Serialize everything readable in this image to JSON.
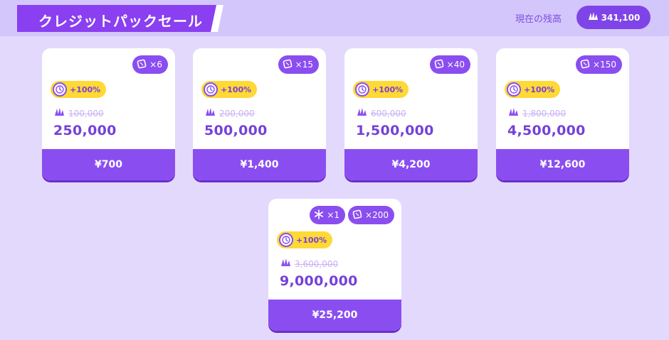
{
  "header": {
    "title": "クレジットパックセール",
    "balance_label": "現在の残高",
    "balance_value": "341,100"
  },
  "colors": {
    "background": "#e3d9fd",
    "accent": "#8a4ef0",
    "bonus": "#ffd935"
  },
  "icons": {
    "credit": "crystal-icon",
    "ticket": "ticket-icon",
    "snowflake": "snowflake-icon",
    "timer": "clock-icon"
  },
  "packs": [
    {
      "badges": [
        {
          "icon": "ticket-icon",
          "label": "×6"
        }
      ],
      "bonus": "+100%",
      "old_amount": "100,000",
      "new_amount": "250,000",
      "price": "¥700"
    },
    {
      "badges": [
        {
          "icon": "ticket-icon",
          "label": "×15"
        }
      ],
      "bonus": "+100%",
      "old_amount": "200,000",
      "new_amount": "500,000",
      "price": "¥1,400"
    },
    {
      "badges": [
        {
          "icon": "ticket-icon",
          "label": "×40"
        }
      ],
      "bonus": "+100%",
      "old_amount": "600,000",
      "new_amount": "1,500,000",
      "price": "¥4,200"
    },
    {
      "badges": [
        {
          "icon": "ticket-icon",
          "label": "×150"
        }
      ],
      "bonus": "+100%",
      "old_amount": "1,800,000",
      "new_amount": "4,500,000",
      "price": "¥12,600"
    },
    {
      "badges": [
        {
          "icon": "snowflake-icon",
          "label": "×1"
        },
        {
          "icon": "ticket-icon",
          "label": "×200"
        }
      ],
      "bonus": "+100%",
      "old_amount": "3,600,000",
      "new_amount": "9,000,000",
      "price": "¥25,200"
    }
  ]
}
